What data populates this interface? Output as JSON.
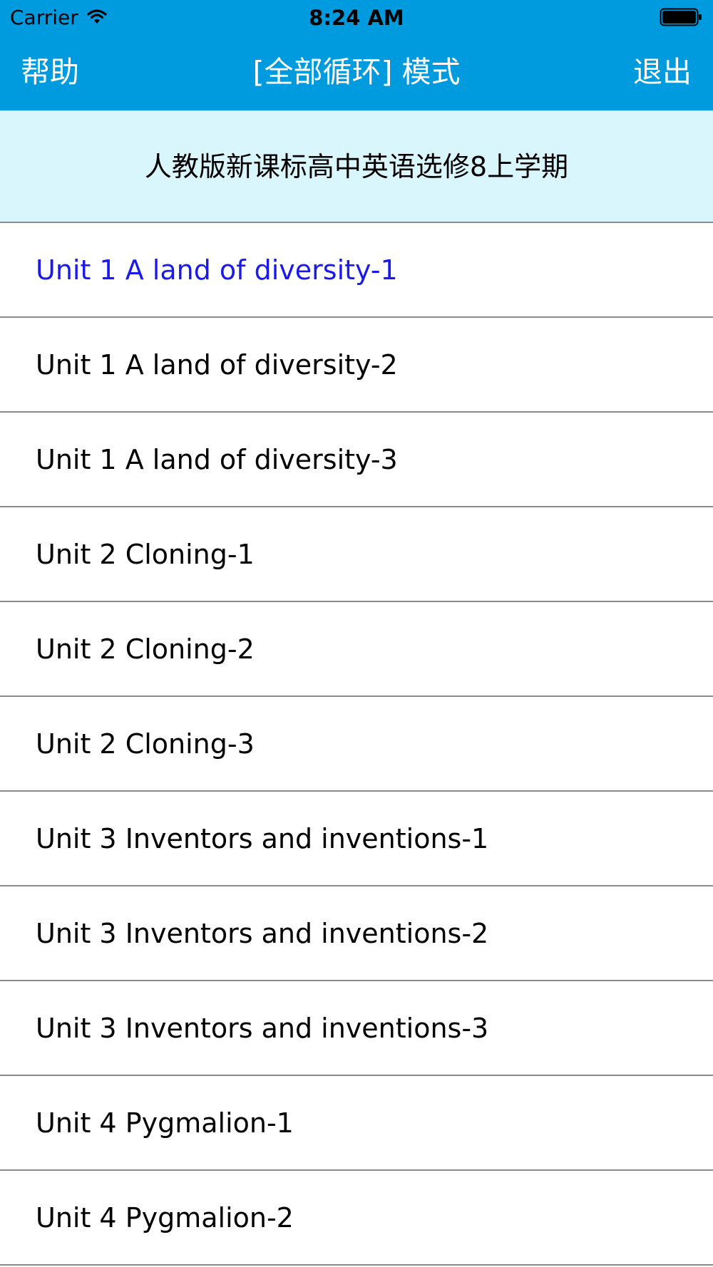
{
  "status_bar": {
    "carrier": "Carrier",
    "time": "8:24 AM",
    "wifi_icon": "wifi-icon",
    "battery_icon": "battery-icon"
  },
  "nav": {
    "left_label": "帮助",
    "title": "[全部循环] 模式",
    "right_label": "退出",
    "background_color": "#009bde",
    "text_color": "#ffffff"
  },
  "header": {
    "title": "人教版新课标高中英语选修8上学期",
    "background_color": "#d8f6fc"
  },
  "list": {
    "active_color": "#1a1af0",
    "items": [
      {
        "label": "Unit 1 A land of diversity-1",
        "active": true
      },
      {
        "label": "Unit 1 A land of diversity-2",
        "active": false
      },
      {
        "label": "Unit 1 A land of diversity-3",
        "active": false
      },
      {
        "label": "Unit 2 Cloning-1",
        "active": false
      },
      {
        "label": "Unit 2 Cloning-2",
        "active": false
      },
      {
        "label": "Unit 2 Cloning-3",
        "active": false
      },
      {
        "label": "Unit 3 Inventors and inventions-1",
        "active": false
      },
      {
        "label": "Unit 3 Inventors and inventions-2",
        "active": false
      },
      {
        "label": "Unit 3 Inventors and inventions-3",
        "active": false
      },
      {
        "label": "Unit 4 Pygmalion-1",
        "active": false
      },
      {
        "label": "Unit 4 Pygmalion-2",
        "active": false
      }
    ]
  }
}
